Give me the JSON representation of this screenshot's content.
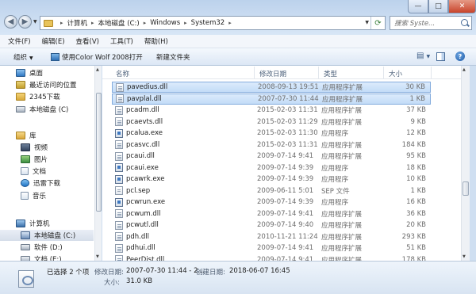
{
  "address": {
    "crumbs": [
      "计算机",
      "本地磁盘 (C:)",
      "Windows",
      "System32"
    ]
  },
  "search": {
    "placeholder": "搜索 Syste..."
  },
  "window_controls": {
    "minimize": "—",
    "maximize": "□",
    "close": "✕"
  },
  "menu": [
    "文件(F)",
    "编辑(E)",
    "查看(V)",
    "工具(T)",
    "帮助(H)"
  ],
  "toolbar": {
    "organize": "组织",
    "open_with": "使用Color Wolf 2008打开",
    "new_folder": "新建文件夹"
  },
  "nav": {
    "favorites": [
      {
        "label": "桌面",
        "icon": "desktop-icon"
      },
      {
        "label": "最近访问的位置",
        "icon": "recent-places-icon"
      },
      {
        "label": "2345下载",
        "icon": "folder-icon"
      },
      {
        "label": "本地磁盘 (C)",
        "icon": "drive-icon"
      }
    ],
    "libraries_label": "库",
    "libraries": [
      {
        "label": "视频",
        "icon": "video-library-icon"
      },
      {
        "label": "图片",
        "icon": "picture-library-icon"
      },
      {
        "label": "文档",
        "icon": "document-library-icon"
      },
      {
        "label": "迅雷下载",
        "icon": "thunder-download-icon"
      },
      {
        "label": "音乐",
        "icon": "music-library-icon"
      }
    ],
    "computer_label": "计算机",
    "drives": [
      {
        "label": "本地磁盘 (C:)",
        "icon": "drive-icon",
        "selected": true
      },
      {
        "label": "软件 (D:)",
        "icon": "drive-icon"
      },
      {
        "label": "文档 (E:)",
        "icon": "drive-icon"
      }
    ]
  },
  "columns": {
    "name": "名称",
    "date": "修改日期",
    "type": "类型",
    "size": "大小"
  },
  "files": [
    {
      "name": "pavedius.dll",
      "date": "2008-09-13 19:51",
      "type": "应用程序扩展",
      "size": "30 KB",
      "kind": "dll",
      "selected": true
    },
    {
      "name": "pavplal.dll",
      "date": "2007-07-30 11:44",
      "type": "应用程序扩展",
      "size": "1 KB",
      "kind": "dll",
      "selected": true
    },
    {
      "name": "pcadm.dll",
      "date": "2015-02-03 11:31",
      "type": "应用程序扩展",
      "size": "37 KB",
      "kind": "dll"
    },
    {
      "name": "pcaevts.dll",
      "date": "2015-02-03 11:29",
      "type": "应用程序扩展",
      "size": "9 KB",
      "kind": "dll"
    },
    {
      "name": "pcalua.exe",
      "date": "2015-02-03 11:30",
      "type": "应用程序",
      "size": "12 KB",
      "kind": "exe"
    },
    {
      "name": "pcasvc.dll",
      "date": "2015-02-03 11:31",
      "type": "应用程序扩展",
      "size": "184 KB",
      "kind": "dll"
    },
    {
      "name": "pcaui.dll",
      "date": "2009-07-14 9:41",
      "type": "应用程序扩展",
      "size": "95 KB",
      "kind": "dll"
    },
    {
      "name": "pcaui.exe",
      "date": "2009-07-14 9:39",
      "type": "应用程序",
      "size": "18 KB",
      "kind": "exe"
    },
    {
      "name": "pcawrk.exe",
      "date": "2009-07-14 9:39",
      "type": "应用程序",
      "size": "10 KB",
      "kind": "exe"
    },
    {
      "name": "pcl.sep",
      "date": "2009-06-11 5:01",
      "type": "SEP 文件",
      "size": "1 KB",
      "kind": "sep"
    },
    {
      "name": "pcwrun.exe",
      "date": "2009-07-14 9:39",
      "type": "应用程序",
      "size": "16 KB",
      "kind": "exe"
    },
    {
      "name": "pcwum.dll",
      "date": "2009-07-14 9:41",
      "type": "应用程序扩展",
      "size": "36 KB",
      "kind": "dll"
    },
    {
      "name": "pcwutl.dll",
      "date": "2009-07-14 9:40",
      "type": "应用程序扩展",
      "size": "20 KB",
      "kind": "dll"
    },
    {
      "name": "pdh.dll",
      "date": "2010-11-21 11:24",
      "type": "应用程序扩展",
      "size": "293 KB",
      "kind": "dll"
    },
    {
      "name": "pdhui.dll",
      "date": "2009-07-14 9:41",
      "type": "应用程序扩展",
      "size": "51 KB",
      "kind": "dll"
    },
    {
      "name": "PeerDist.dll",
      "date": "2009-07-14 9:41",
      "type": "应用程序扩展",
      "size": "178 KB",
      "kind": "dll"
    }
  ],
  "details": {
    "selected_text": "已选择 2 个项",
    "modified_label": "修改日期:",
    "modified_value": "2007-07-30 11:44 - 2...",
    "created_label": "创建日期:",
    "created_value": "2018-06-07 16:45",
    "size_label": "大小:",
    "size_value": "31.0 KB"
  }
}
